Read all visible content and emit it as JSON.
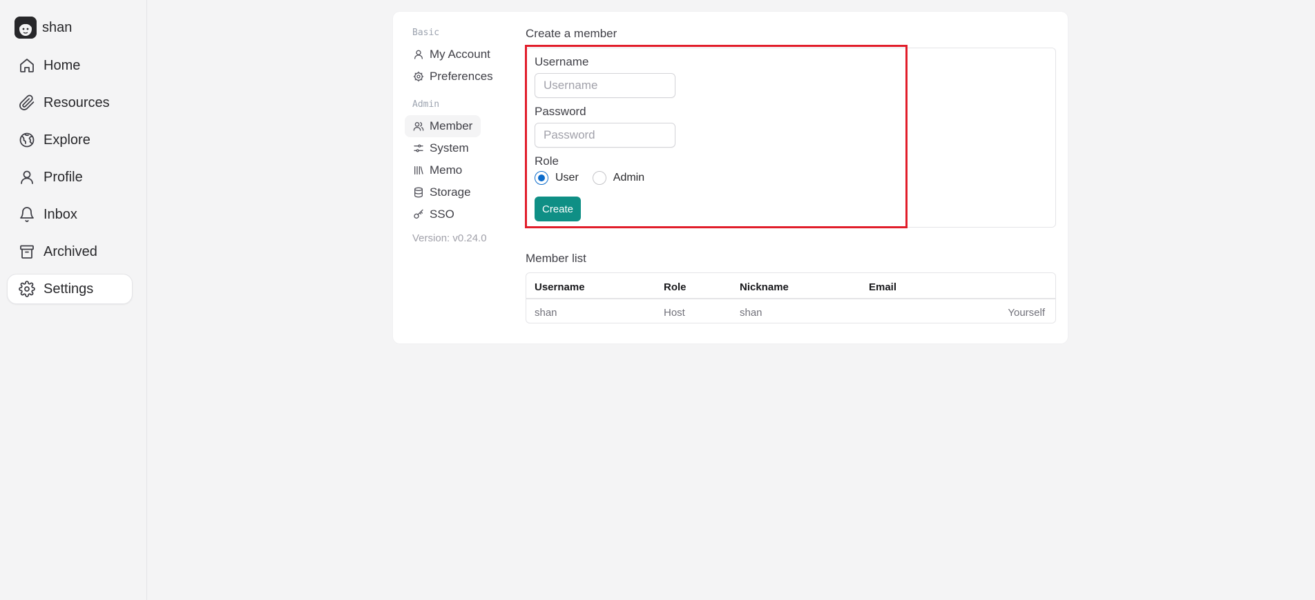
{
  "user": {
    "name": "shan"
  },
  "nav": {
    "items": [
      {
        "label": "Home",
        "icon": "home-icon"
      },
      {
        "label": "Resources",
        "icon": "paperclip-icon"
      },
      {
        "label": "Explore",
        "icon": "globe-icon"
      },
      {
        "label": "Profile",
        "icon": "user-icon"
      },
      {
        "label": "Inbox",
        "icon": "bell-icon"
      },
      {
        "label": "Archived",
        "icon": "archive-icon"
      },
      {
        "label": "Settings",
        "icon": "gear-icon"
      }
    ],
    "active": "Settings"
  },
  "settings_menu": {
    "basic_title": "Basic",
    "admin_title": "Admin",
    "basic": [
      {
        "label": "My Account",
        "icon": "user-icon"
      },
      {
        "label": "Preferences",
        "icon": "cog-icon"
      }
    ],
    "admin": [
      {
        "label": "Member",
        "icon": "users-icon"
      },
      {
        "label": "System",
        "icon": "sliders-icon"
      },
      {
        "label": "Memo",
        "icon": "library-icon"
      },
      {
        "label": "Storage",
        "icon": "database-icon"
      },
      {
        "label": "SSO",
        "icon": "key-icon"
      }
    ],
    "active": "Member",
    "version": "Version: v0.24.0"
  },
  "create_member": {
    "title": "Create a member",
    "username_label": "Username",
    "username_placeholder": "Username",
    "password_label": "Password",
    "password_placeholder": "Password",
    "role_label": "Role",
    "roles": [
      {
        "label": "User",
        "checked": true
      },
      {
        "label": "Admin",
        "checked": false
      }
    ],
    "create_button": "Create"
  },
  "member_list": {
    "title": "Member list",
    "columns": [
      "Username",
      "Role",
      "Nickname",
      "Email"
    ],
    "rows": [
      {
        "username": "shan",
        "role": "Host",
        "nickname": "shan",
        "email": "",
        "action": "Yourself"
      }
    ]
  },
  "colors": {
    "accent": "#0f8f85",
    "radio_selected": "#0b6bcb",
    "highlight_box": "#e11d2a",
    "background": "#f4f4f5"
  }
}
